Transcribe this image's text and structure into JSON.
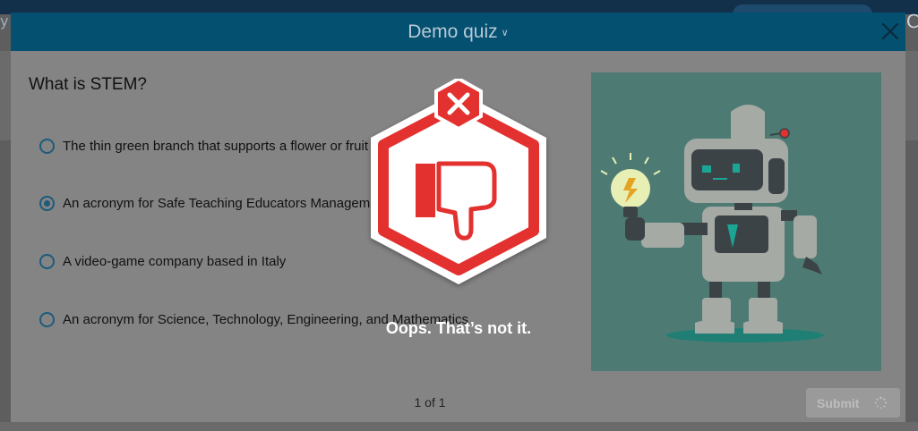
{
  "modal": {
    "title": "Demo quiz",
    "title_chevron_icon": "chevron-down-icon",
    "close_icon": "close-icon",
    "accent_color": "#045071"
  },
  "quiz": {
    "question": "What is STEM?",
    "options": [
      {
        "label": "The thin green branch that supports a flower or fruit",
        "selected": false
      },
      {
        "label": "An acronym for Safe Teaching Educators Managem",
        "selected": true
      },
      {
        "label": "A video-game company based in Italy",
        "selected": false
      },
      {
        "label": "An acronym for Science, Technology, Engineering, and Mathematics",
        "selected": false
      }
    ],
    "illustration": "robot-holding-lightbulb"
  },
  "footer": {
    "pager": "1 of 1",
    "submit_label": "Submit",
    "loading_icon": "spinner-icon"
  },
  "feedback": {
    "status": "incorrect",
    "badge_icon": "thumbs-down-icon",
    "status_icon": "x-icon",
    "message": "Oops. That’s not it.",
    "color": "#e3312f"
  },
  "background": {
    "left_edge_text": "y",
    "right_edge_text": "Cc"
  }
}
